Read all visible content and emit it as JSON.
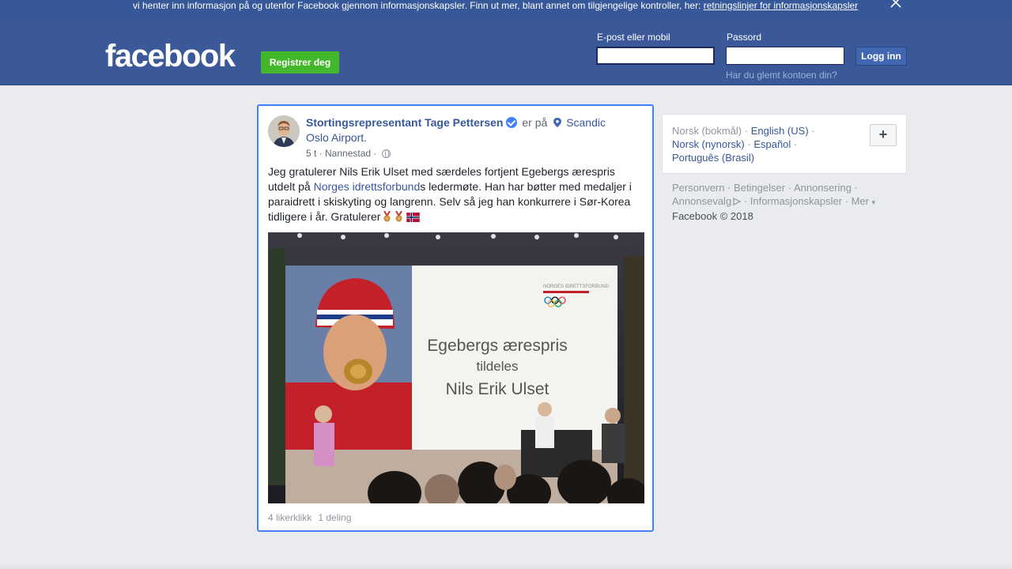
{
  "cookie_banner": {
    "text": "vi henter inn informasjon på og utenfor Facebook gjennom informasjonskapsler. Finn ut mer, blant annet om tilgjengelige kontroller, her:",
    "link": "retningslinjer for informasjonskapsler"
  },
  "header": {
    "logo": "facebook",
    "register_label": "Registrer deg",
    "email_label": "E-post eller mobil",
    "email_value": "",
    "password_label": "Passord",
    "password_value": "",
    "login_label": "Logg inn",
    "forgot_link": "Har du glemt kontoen din?"
  },
  "post": {
    "author": "Stortingsrepresentant Tage Pettersen",
    "is_at": "er på",
    "place": "Scandic Oslo Airport.",
    "time": "5 t",
    "location": "Nannestad",
    "text_before": "Jeg gratulerer Nils Erik Ulset med særdeles fortjent Egebergs ærespris utdelt på ",
    "text_link": "Norges idrettsforbund",
    "text_after": "s ledermøte. Han har bøtter med medaljer i paraidrett i skiskyting og langrenn. Selv så jeg han konkurrere i Sør-Korea tidligere i år. Gratulerer",
    "image": {
      "slide_title": "Egebergs ærespris",
      "slide_sub": "tildeles",
      "slide_name": "Nils Erik Ulset",
      "slide_org": "NORGES IDRETTSFORBUND"
    },
    "likes": "4 likerklikk",
    "shares": "1 deling"
  },
  "sidebar": {
    "current_language": "Norsk (bokmål)",
    "languages": [
      "English (US)",
      "Norsk (nynorsk)",
      "Español",
      "Português (Brasil)"
    ],
    "add_language": "+",
    "footer_links": [
      "Personvern",
      "Betingelser",
      "Annonsering",
      "Annonsevalg",
      "Informasjonskapsler",
      "Mer"
    ],
    "copyright": "Facebook © 2018"
  },
  "colors": {
    "brand_blue": "#3b5998",
    "link_blue": "#365899",
    "register_green": "#42b72a",
    "focus_border": "#4080ff"
  }
}
